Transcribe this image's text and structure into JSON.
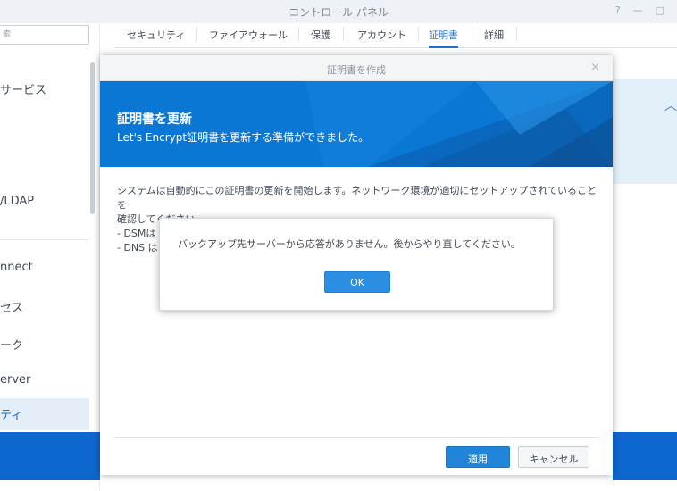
{
  "window": {
    "title": "コントロール パネル",
    "controls": [
      "?",
      "—",
      "□"
    ]
  },
  "sidebar": {
    "search_text": "索",
    "items": [
      {
        "label": "サービス",
        "active": false
      },
      {
        "label": "/LDAP",
        "active": false
      },
      {
        "label": "nnect",
        "active": false
      },
      {
        "label": "セス",
        "active": false
      },
      {
        "label": "ーク",
        "active": false
      },
      {
        "label": "erver",
        "active": false
      },
      {
        "label": "ティ",
        "active": true
      }
    ]
  },
  "tabs": [
    {
      "label": "セキュリティ",
      "active": false
    },
    {
      "label": "ファイアウォール",
      "active": false
    },
    {
      "label": "保護",
      "active": false
    },
    {
      "label": "アカウント",
      "active": false
    },
    {
      "label": "証明書",
      "active": true
    },
    {
      "label": "詳細",
      "active": false
    }
  ],
  "wizard": {
    "title": "証明書を作成",
    "close_icon": "×",
    "banner_title": "証明書を更新",
    "banner_subtitle": "Let's Encrypt証明書を更新する準備ができました。",
    "body_lines": [
      "システムは自動的にこの証明書の更新を開始します。ネットワーク環境が適切にセットアップされていることを",
      "確認してください。",
      "- DSMは",
      "- DNS は"
    ],
    "apply_label": "適用",
    "cancel_label": "キャンセル"
  },
  "message_box": {
    "text": "バックアップ先サーバーから応答がありません。後からやり直してください。",
    "ok_label": "OK"
  },
  "colors": {
    "banner_blue": "#0a77d4",
    "accent_blue": "#2385da",
    "active_tab": "#1d73c4",
    "bottom_bar": "#0e67cf"
  }
}
